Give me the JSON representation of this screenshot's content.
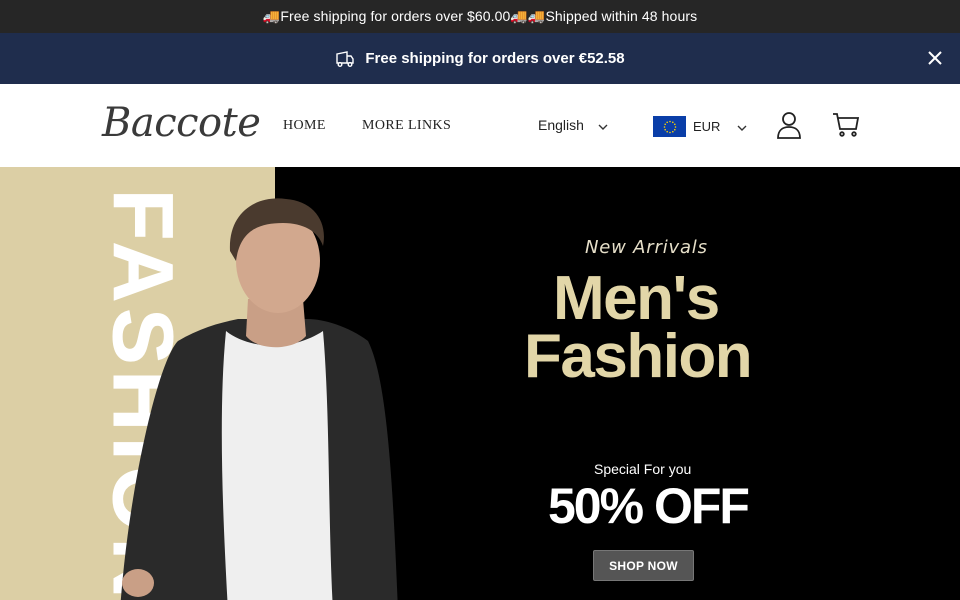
{
  "topbar": {
    "text": "🚚Free shipping for orders over $60.00🚚🚚Shipped within 48 hours"
  },
  "announcement": {
    "message": "Free shipping for orders over €52.58",
    "icon": "truck-icon",
    "close_icon": "close-icon"
  },
  "header": {
    "logo": "Baccote",
    "nav": [
      {
        "label": "HOME"
      },
      {
        "label": "MORE LINKS"
      }
    ],
    "language": {
      "label": "English",
      "icon": "chevron-down-icon"
    },
    "currency": {
      "code": "EUR",
      "flag": "eu-flag-icon",
      "icon": "chevron-down-icon"
    },
    "account_icon": "user-icon",
    "cart_icon": "cart-icon"
  },
  "hero": {
    "vertical_word": "FASHION",
    "subtitle": "New Arrivals",
    "title_line1": "Men's",
    "title_line2": "Fashion",
    "special": "Special For you",
    "discount": "50% OFF",
    "cta": "SHOP NOW",
    "colors": {
      "beige": "#dccfa5",
      "gold": "#e2d6a8",
      "background": "#000000"
    }
  }
}
